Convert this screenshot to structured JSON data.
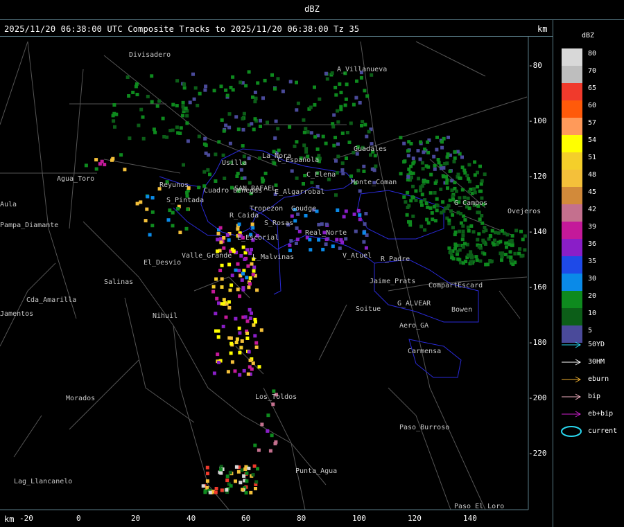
{
  "window": {
    "title": "dBZ"
  },
  "header": {
    "text": "2025/11/20 06:38:00 UTC Composite Tracks to 2025/11/20 06:38:00 Tz 35",
    "km_label": "km"
  },
  "axes": {
    "km_label": "km",
    "x_ticks": [
      "-20",
      "0",
      "20",
      "40",
      "60",
      "80",
      "100",
      "120",
      "140"
    ],
    "y_ticks": [
      "-80",
      "-100",
      "-120",
      "-140",
      "-160",
      "-180",
      "-200",
      "-220"
    ]
  },
  "legend": {
    "title": "dBZ",
    "items": [
      {
        "label": "80",
        "color": "#d8d8d8"
      },
      {
        "label": "70",
        "color": "#bebebe"
      },
      {
        "label": "65",
        "color": "#f03a2c"
      },
      {
        "label": "60",
        "color": "#ff5a0a"
      },
      {
        "label": "57",
        "color": "#ff9a5a"
      },
      {
        "label": "54",
        "color": "#ffff00"
      },
      {
        "label": "51",
        "color": "#f4cf2a"
      },
      {
        "label": "48",
        "color": "#f4c03a"
      },
      {
        "label": "45",
        "color": "#d28a3a"
      },
      {
        "label": "42",
        "color": "#c4708e"
      },
      {
        "label": "39",
        "color": "#c4199a"
      },
      {
        "label": "36",
        "color": "#8a1ec8"
      },
      {
        "label": "35",
        "color": "#1e4ae8"
      },
      {
        "label": "30",
        "color": "#0a8ae8"
      },
      {
        "label": "20",
        "color": "#0e8a1e"
      },
      {
        "label": "10",
        "color": "#0c5e18"
      },
      {
        "label": "5",
        "color": "#4a4a9a"
      }
    ]
  },
  "tracks": [
    {
      "label": "50YD",
      "color": "#2ad8f0"
    },
    {
      "label": "30HM",
      "color": "#ffffff"
    },
    {
      "label": "eburn",
      "color": "#f0b030"
    },
    {
      "label": "bip",
      "color": "#f0b0c0"
    },
    {
      "label": "eb+bip",
      "color": "#d020d0"
    },
    {
      "label": "current",
      "color": "#2ad8f0"
    }
  ],
  "map": {
    "places": [
      {
        "name": "Divisadero"
      },
      {
        "name": "A_Villanueva"
      },
      {
        "name": "Guadales"
      },
      {
        "name": "La_Nora"
      },
      {
        "name": "Usilla"
      },
      {
        "name": "C_Española"
      },
      {
        "name": "C_Elena"
      },
      {
        "name": "Cuadro Benegas"
      },
      {
        "name": "SAN_RAFAEL"
      },
      {
        "name": "E_Algarrobal"
      },
      {
        "name": "Goudge"
      },
      {
        "name": "Tropezon"
      },
      {
        "name": "S_Rosas"
      },
      {
        "name": "R_Caida"
      },
      {
        "name": "Real_Norte"
      },
      {
        "name": "E_Escorial"
      },
      {
        "name": "L_Malvinas"
      },
      {
        "name": "Valle_Grande"
      },
      {
        "name": "El_Desvio"
      },
      {
        "name": "Salinas"
      },
      {
        "name": "Reyunos"
      },
      {
        "name": "S_Pintada"
      },
      {
        "name": "Agua_Toro"
      },
      {
        "name": "Pampa_Diamante"
      },
      {
        "name": "Cda_Amarilla"
      },
      {
        "name": "Nihuil"
      },
      {
        "name": "Soitue"
      },
      {
        "name": "Bowen"
      },
      {
        "name": "Aero_GA"
      },
      {
        "name": "Carmensa"
      },
      {
        "name": "Compart"
      },
      {
        "name": "Escard"
      },
      {
        "name": "V_Atuel"
      },
      {
        "name": "G_Campos"
      },
      {
        "name": "Los_Toldos"
      },
      {
        "name": "Morados"
      },
      {
        "name": "Paso_Burroso"
      },
      {
        "name": "Punta_Agua"
      },
      {
        "name": "Lag_Llancanelo"
      },
      {
        "name": "Paso_El_Loro"
      },
      {
        "name": "Ovejeros"
      },
      {
        "name": "Monte_Coman"
      },
      {
        "name": "Jaime_Prats"
      },
      {
        "name": "G_ALVEAR"
      },
      {
        "name": "R_Padre"
      },
      {
        "name": "Aula"
      },
      {
        "name": "Jamentos"
      }
    ]
  }
}
